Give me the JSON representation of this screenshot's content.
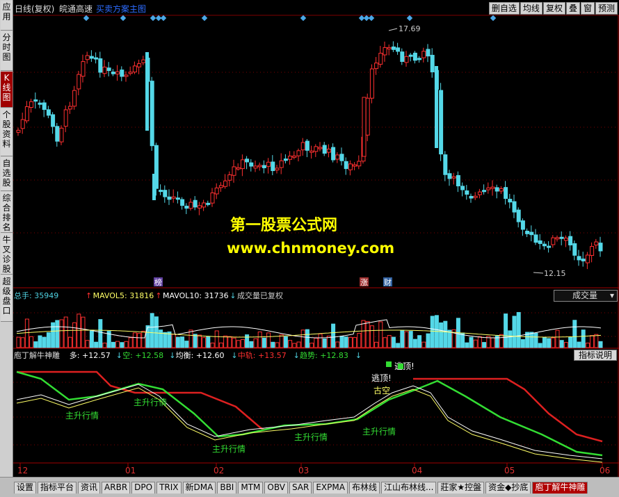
{
  "sidebar": {
    "tabs": [
      "应用",
      "分时图",
      "K线图",
      "个股资料",
      "自选股",
      "综合排名",
      "牛叉诊股",
      "超级盘口"
    ],
    "active_index": 2
  },
  "header": {
    "period": "日线(复权)",
    "stock_name": "皖通高速",
    "indicator": "买卖方案主图"
  },
  "toolbar": [
    "删自选",
    "均线",
    "复权",
    "叠",
    "窗",
    "预测"
  ],
  "price_chart": {
    "high_label": "17.69",
    "low_label": "12.15",
    "markers": [
      "榜",
      "涨",
      "财"
    ],
    "watermark_title": "第一股票公式网",
    "watermark_url": "www.chnmoney.com"
  },
  "volume_panel": {
    "total": "总手: 35949",
    "total_arrow": "↑",
    "mavol5": "MAVOL5: 31816",
    "mavol5_arrow": "↑",
    "mavol10": "MAVOL10: 31736",
    "mavol10_arrow": "↓",
    "note": "成交量已复权",
    "dropdown": "成交量"
  },
  "indicator_panel": {
    "name": "庖丁解牛神雕",
    "duo": "多: +12.57",
    "duo_arrow": "↓",
    "kong": "空: +12.58",
    "kong_arrow": "↓",
    "junheng": "均衡: +12.60",
    "junheng_arrow": "↓",
    "zhongzhi": "中轨: +13.57",
    "zhongzhi_arrow": "↓",
    "qushi": "趋势: +12.83",
    "qushi_arrow": "↓",
    "help_button": "指标说明",
    "labels": [
      "主升行情",
      "主升行情",
      "主升行情",
      "主升行情",
      "主升行情",
      "逃顶!",
      "逃顶!",
      "古空"
    ]
  },
  "x_axis": [
    "12",
    "01",
    "02",
    "03",
    "04",
    "05",
    "06"
  ],
  "bottom_tabs": [
    "设置",
    "指标平台",
    "资讯",
    "ARBR",
    "DPO",
    "TRIX",
    "新DMA",
    "BBI",
    "MTM",
    "OBV",
    "SAR",
    "EXPMA",
    "布林线",
    "江山布林线...",
    "莊家★控盤",
    "资金◆抄底",
    "庖丁解牛神雕"
  ],
  "bottom_active_index": 16,
  "colors": {
    "up": "#ff3030",
    "down": "#54d8e8",
    "yellow": "#ffff00",
    "green": "#33dd33",
    "red_line": "#dd2020",
    "marker": "#4aa8e8"
  }
}
